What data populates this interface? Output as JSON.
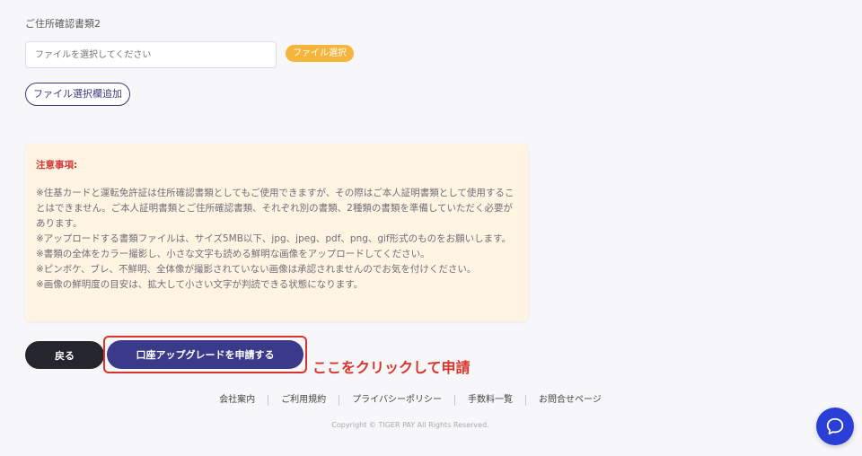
{
  "upload": {
    "section_label": "ご住所確認書類2",
    "file_placeholder": "ファイルを選択してください",
    "select_button": "ファイル選択",
    "add_field_button": "ファイル選択欄追加"
  },
  "notice": {
    "title": "注意事項:",
    "lines": [
      "※住基カードと運転免許証は住所確認書類としてもご使用できますが、その際はご本人証明書類として使用することはできません。ご本人証明書類とご住所確認書類、それぞれ別の書類、2種類の書類を準備していただく必要があります。",
      "※アップロードする書類ファイルは、サイズ5MB以下、jpg、jpeg、pdf、png、gif形式のものをお願いします。",
      "※書類の全体をカラー撮影し、小さな文字も読める鮮明な画像をアップロードしてください。",
      "※ピンボケ、ブレ、不鮮明、全体像が撮影されていない画像は承認されませんのでお気を付けください。",
      "※画像の鮮明度の目安は、拡大して小さい文字が判読できる状態になります。"
    ]
  },
  "actions": {
    "back_label": "戻る",
    "upgrade_label": "口座アップグレードを申請する"
  },
  "annotation": "ここをクリックして申請",
  "footer": {
    "links": [
      "会社案内",
      "ご利用規約",
      "プライバシーポリシー",
      "手数料一覧",
      "お問合せページ"
    ],
    "copyright": "Copyright © TIGER PAY All Rights Reserved."
  },
  "colors": {
    "accent_orange": "#f5b53b",
    "primary_navy": "#3b3a8a",
    "dark_button": "#24252d",
    "notice_bg": "#fff3e2",
    "annotation_red": "#d9342b",
    "chat_blue": "#2a3fd6"
  },
  "icons": {
    "chat": "chat-bubble-icon"
  }
}
